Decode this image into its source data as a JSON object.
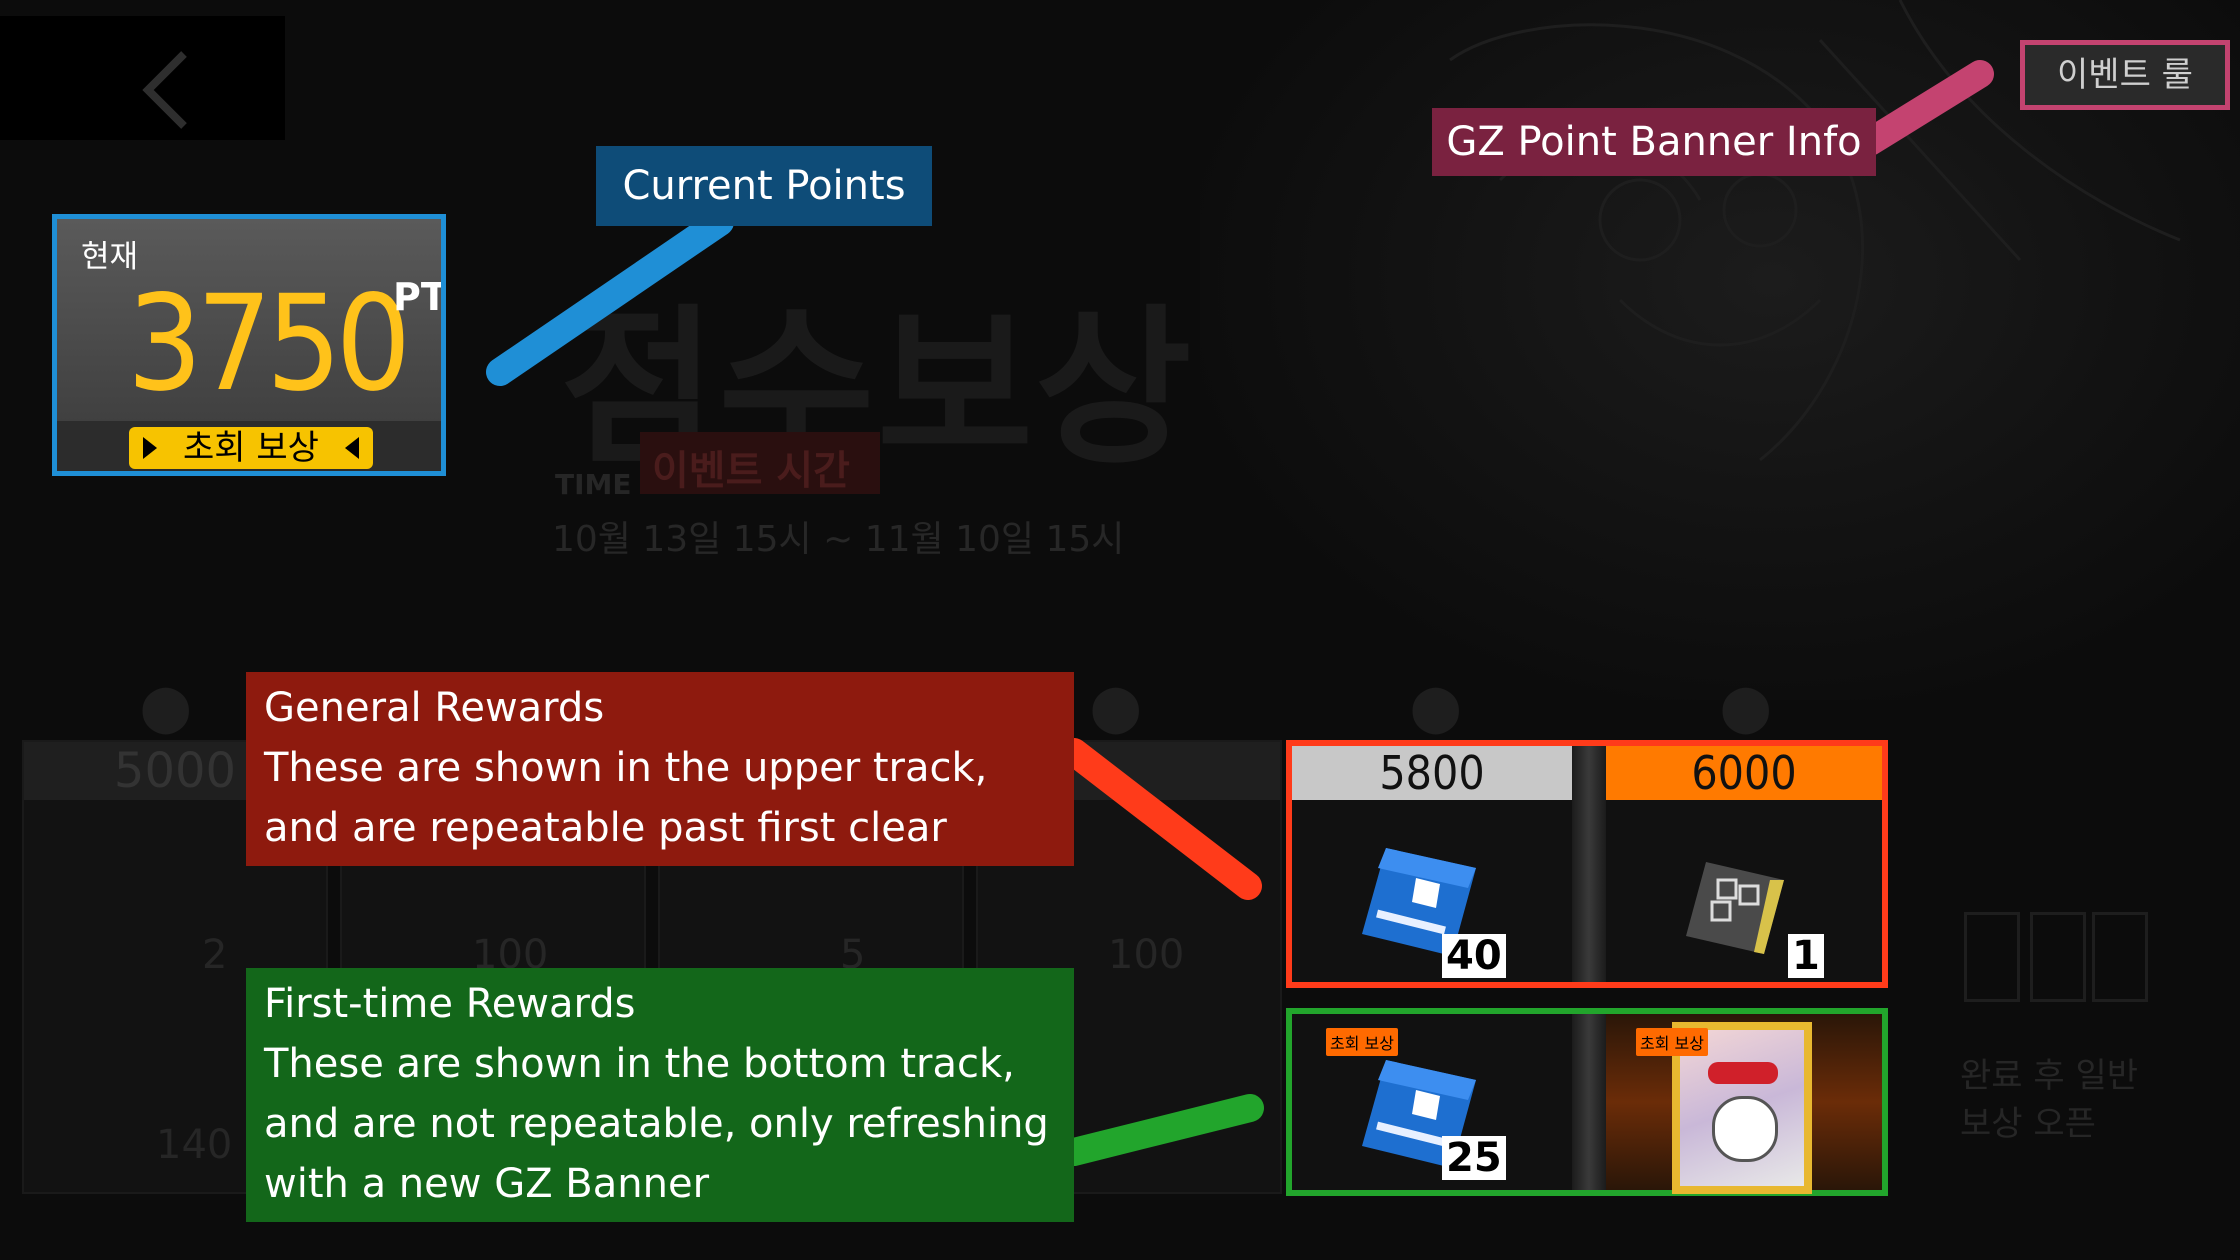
{
  "header": {
    "back_label": "",
    "rules_button": "이벤트 룰"
  },
  "banner": {
    "title": "점수보상",
    "time_label": "TIME",
    "event_time_label": "이벤트 시간",
    "dates": "10월 13일 15시 ~ 11월 10일 15시"
  },
  "points": {
    "label": "현재",
    "value": "3750",
    "unit": "PT",
    "first_clear_button": "초회 보상"
  },
  "annotations": {
    "current_points": "Current Points",
    "gz_banner_info": "GZ Point Banner Info",
    "general_rewards": {
      "title": "General Rewards",
      "line1": "These are shown in the upper track,",
      "line2": "and are repeatable past first clear"
    },
    "first_time_rewards": {
      "title": "First-time Rewards",
      "line1": "These are shown in the bottom track,",
      "line2": "and are not repeatable, only refreshing",
      "line3": "with a new GZ Banner"
    }
  },
  "track_dim": {
    "cells": [
      {
        "score": "5000",
        "upper_qty": "2",
        "lower_qty": "140"
      },
      {
        "score": "",
        "upper_qty": "100",
        "lower_qty": ""
      },
      {
        "score": "",
        "upper_qty": "5",
        "lower_qty": ""
      },
      {
        "score": "",
        "upper_qty": "100",
        "lower_qty": ""
      }
    ],
    "right_text_line1": "완료 후 일반",
    "right_text_line2": "보상 오픈"
  },
  "rewards": {
    "upper": [
      {
        "score": "5800",
        "item_icon": "blue-ticket-icon",
        "qty": "40",
        "head_color": "#c8c8c8"
      },
      {
        "score": "6000",
        "item_icon": "gray-card-icon",
        "qty": "1",
        "head_color": "#ff7a00"
      }
    ],
    "lower": [
      {
        "tag": "초회 보상",
        "item_icon": "blue-ticket-icon",
        "qty": "25"
      },
      {
        "tag": "초회 보상",
        "item_icon": "character-card-icon",
        "qty": ""
      }
    ]
  },
  "colors": {
    "current_points": "#1f8fd6",
    "gz_banner": "#c44370",
    "general": "#ff3b1a",
    "first_time": "#22a52c",
    "points_value": "#ffc21a"
  }
}
